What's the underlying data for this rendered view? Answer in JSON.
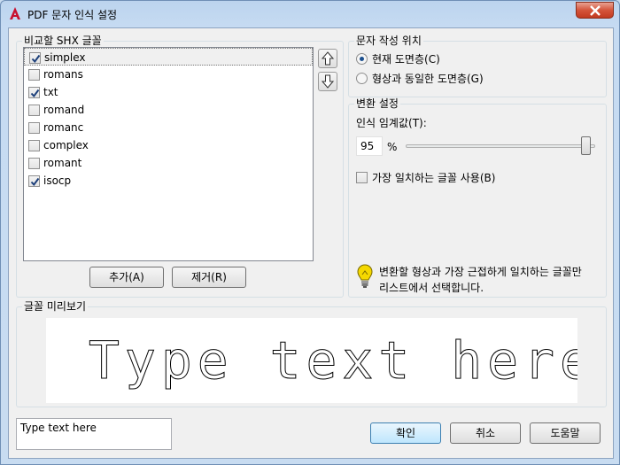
{
  "window": {
    "title": "PDF 문자 인식 설정"
  },
  "shx_group": {
    "title": "비교할 SHX 글꼴",
    "fonts": [
      {
        "name": "simplex",
        "checked": true,
        "selected": true
      },
      {
        "name": "romans",
        "checked": false,
        "selected": false
      },
      {
        "name": "txt",
        "checked": true,
        "selected": false
      },
      {
        "name": "romand",
        "checked": false,
        "selected": false
      },
      {
        "name": "romanc",
        "checked": false,
        "selected": false
      },
      {
        "name": "complex",
        "checked": false,
        "selected": false
      },
      {
        "name": "romant",
        "checked": false,
        "selected": false
      },
      {
        "name": "isocp",
        "checked": true,
        "selected": false
      }
    ],
    "add_label": "추가(A)",
    "remove_label": "제거(R)",
    "move_up_icon": "arrow-up-icon",
    "move_down_icon": "arrow-down-icon"
  },
  "text_position": {
    "title": "문자 작성 위치",
    "option_current": "현재 도면층(C)",
    "option_same": "형상과 동일한 도면층(G)",
    "selected": "current"
  },
  "conversion": {
    "title": "변환 설정",
    "threshold_label": "인식 임계값(T):",
    "threshold_value": "95",
    "threshold_unit": "%",
    "threshold_level": 0.95,
    "best_match_label": "가장 일치하는 글꼴 사용(B)",
    "best_match_checked": false,
    "tip_line1": "변환할 형상과 가장 근접하게 일치하는 글꼴만",
    "tip_line2": "리스트에서 선택합니다.",
    "tip_icon": "lightbulb-icon"
  },
  "preview": {
    "title": "글꼴 미리보기",
    "sample_text": "Type text here"
  },
  "footer": {
    "input_value": "Type text here",
    "ok_label": "확인",
    "cancel_label": "취소",
    "help_label": "도움말"
  },
  "colors": {
    "accent": "#1c4f8e",
    "close_button": "#d4543a",
    "app_icon": "#c8102e"
  }
}
